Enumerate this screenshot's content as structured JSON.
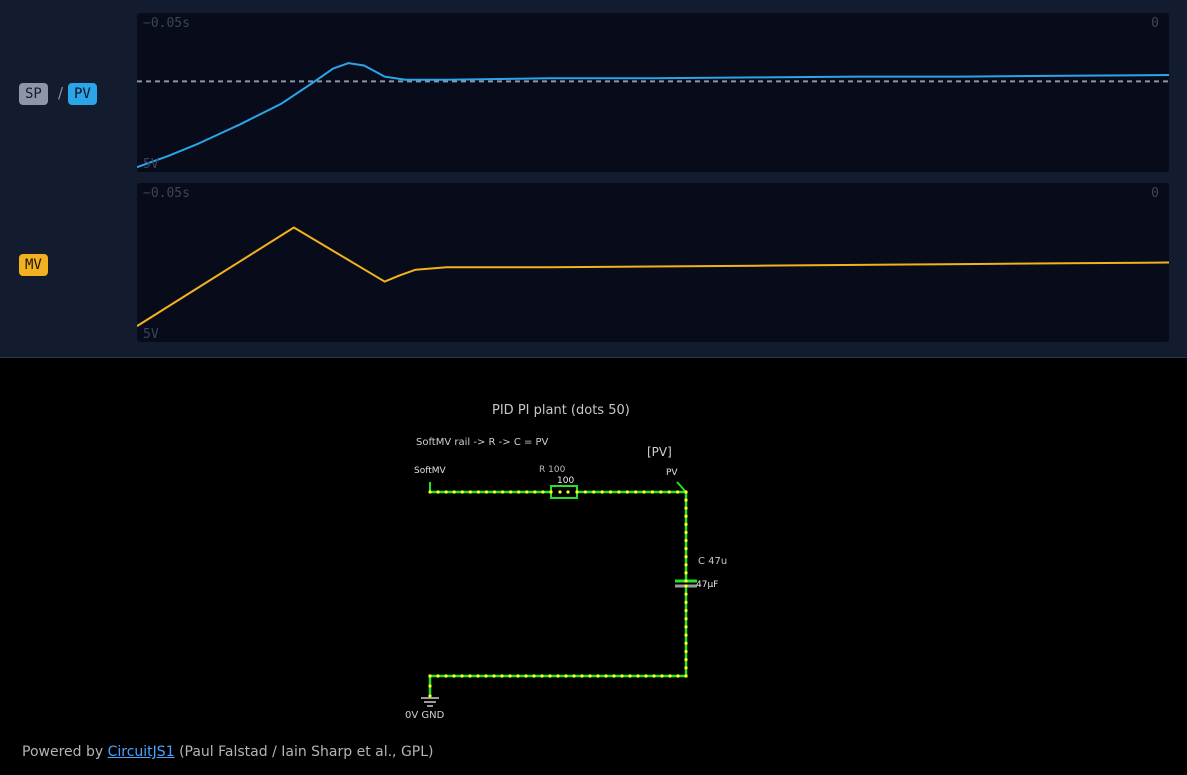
{
  "scope": {
    "sp_label": "SP",
    "separator": "/",
    "pv_label": "PV",
    "mv_label": "MV",
    "time_start": "−0.05s",
    "time_end": "0",
    "scale_label": "5V",
    "colors": {
      "sp": "#8c96a8",
      "pv": "#2aa5e8",
      "mv": "#f2b21f"
    },
    "traces": {
      "sp_setpoint_fraction_from_top": 0.43,
      "pv": [
        [
          0,
          0.97
        ],
        [
          0.03,
          0.9
        ],
        [
          0.06,
          0.82
        ],
        [
          0.1,
          0.7
        ],
        [
          0.14,
          0.57
        ],
        [
          0.17,
          0.44
        ],
        [
          0.19,
          0.35
        ],
        [
          0.205,
          0.315
        ],
        [
          0.22,
          0.33
        ],
        [
          0.24,
          0.4
        ],
        [
          0.26,
          0.42
        ],
        [
          0.3,
          0.42
        ],
        [
          0.4,
          0.41
        ],
        [
          0.5,
          0.41
        ],
        [
          0.6,
          0.405
        ],
        [
          0.7,
          0.4
        ],
        [
          0.8,
          0.4
        ],
        [
          0.9,
          0.395
        ],
        [
          1,
          0.39
        ]
      ],
      "mv": [
        [
          0,
          0.9
        ],
        [
          0.152,
          0.28
        ],
        [
          0.24,
          0.62
        ],
        [
          0.255,
          0.58
        ],
        [
          0.27,
          0.545
        ],
        [
          0.3,
          0.53
        ],
        [
          0.4,
          0.53
        ],
        [
          0.5,
          0.525
        ],
        [
          0.6,
          0.52
        ],
        [
          0.7,
          0.515
        ],
        [
          0.8,
          0.51
        ],
        [
          0.9,
          0.505
        ],
        [
          1,
          0.5
        ]
      ]
    }
  },
  "circuit": {
    "title": "PID PI plant (dots 50)",
    "description": "SoftMV rail -> R -> C = PV",
    "net_label": "[PV]",
    "source_label": "SoftMV",
    "resistor_name": "R 100",
    "resistor_value": "100",
    "node_label": "PV",
    "capacitor_name": "C 47u",
    "capacitor_value": "47µF",
    "ground_label": "0V GND",
    "wire_color": "#27e027",
    "dot_color": "#ffff22"
  },
  "footer": {
    "prefix": "Powered by",
    "link_text": "CircuitJS1",
    "suffix": "(Paul Falstad / Iain Sharp et al., GPL)"
  }
}
